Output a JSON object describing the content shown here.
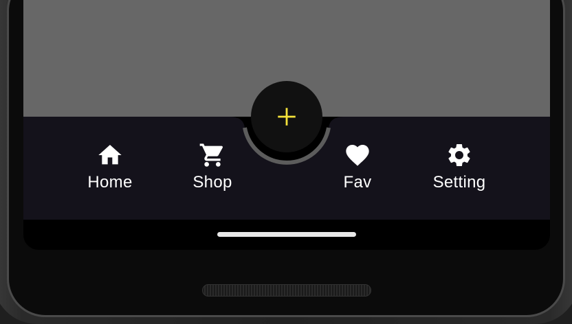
{
  "colors": {
    "content_background": "#676767",
    "navbar_background": "#14121b",
    "fab_background": "#111111",
    "fab_icon": "#f5e33b",
    "nav_icon_label": "#ffffff",
    "home_indicator": "#e8e8e8"
  },
  "fab": {
    "icon": "plus-icon"
  },
  "bottom_nav": {
    "items": [
      {
        "label": "Home",
        "icon": "home-icon"
      },
      {
        "label": "Shop",
        "icon": "cart-icon"
      },
      {
        "label": "Fav",
        "icon": "heart-icon"
      },
      {
        "label": "Setting",
        "icon": "gear-icon"
      }
    ]
  }
}
